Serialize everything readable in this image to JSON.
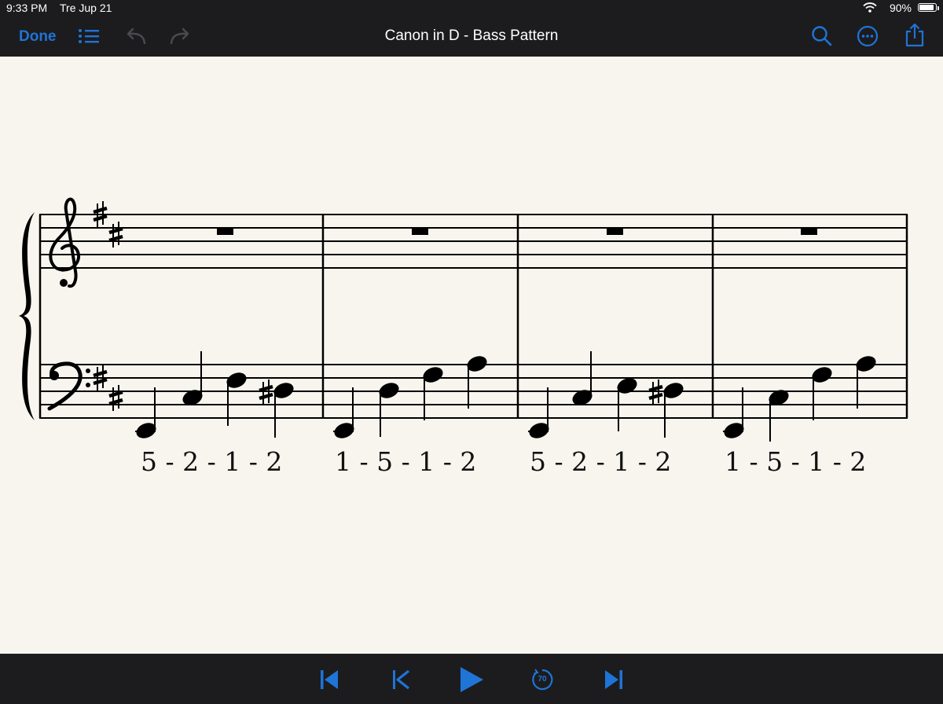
{
  "status": {
    "time": "9:33 PM",
    "date": "Tre Jup 21",
    "battery": "90%"
  },
  "toolbar": {
    "done_label": "Done",
    "title": "Canon in D - Bass Pattern"
  },
  "icons": {
    "list": "list-icon",
    "undo": "undo-icon",
    "redo": "redo-icon",
    "search": "search-icon",
    "more": "more-icon",
    "share": "share-icon"
  },
  "score": {
    "key_signature": "D major (2 sharps)",
    "measures": [
      {
        "fingering": "5 - 2 - 1 - 2"
      },
      {
        "fingering": "1 - 5 - 1 - 2"
      },
      {
        "fingering": "5 - 2 - 1 - 2"
      },
      {
        "fingering": "1 - 5 - 1 - 2"
      }
    ]
  },
  "transport": {
    "tempo_label": "70",
    "controls": [
      "skip-to-start",
      "previous",
      "play",
      "tempo",
      "skip-to-end"
    ]
  },
  "colors": {
    "accent": "#1f74d7",
    "bar": "#1c1c1e",
    "paper": "#f7f5ee"
  }
}
